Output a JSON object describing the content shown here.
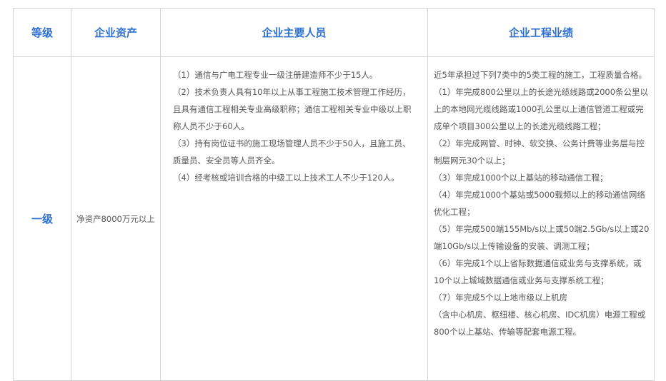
{
  "header": {
    "grade": "等级",
    "assets": "企业资产",
    "personnel": "企业主要人员",
    "performance": "企业工程业绩"
  },
  "row": {
    "grade": "一级",
    "assets": "净资产8000万元以上",
    "personnel": [
      "（1）通信与广电工程专业一级注册建造师不少于15人。",
      "（2）技术负责人具有10年以上从事工程施工技术管理工作经历，且具有通信工程相关专业高级职称；通信工程相关专业中级以上职称人员不少于60人。",
      "（3）持有岗位证书的施工现场管理人员不少于50人，且施工员、质量员、安全员等人员齐全。",
      "（4）经考核或培训合格的中级工以上技术工人不少于120人。"
    ],
    "performance": [
      "近5年承担过下列7类中的5类工程的施工，工程质量合格。",
      "（1）年完成800公里以上的长途光缆线路或2000条公里以上的本地网光缆线路或1000孔公里以上通信管道工程或完成单个项目300公里以上的长途光缆线路工程；",
      "（2）年完成网管、时钟、软交换、公务计费等业务层与控制层网元30个以上；",
      "（3）年完成1000个以上基站的移动通信工程；",
      "（4）年完成1000个基站或5000载频以上的移动通信网络优化工程；",
      "（5）年完成500端155Mb/s以上或50端2.5Gb/s以上或20端10Gb/s以上传输设备的安装、调测工程；",
      "（6）年完成1个以上省际数据通信或业务与支撑系统，或10个以上城域数据通信或业务与支撑系统工程；",
      "（7）年完成5个以上地市级以上机房",
      "（含中心机房、枢纽楼、核心机房、IDC机房）电源工程或800个以上基站、传输等配套电源工程。"
    ]
  }
}
